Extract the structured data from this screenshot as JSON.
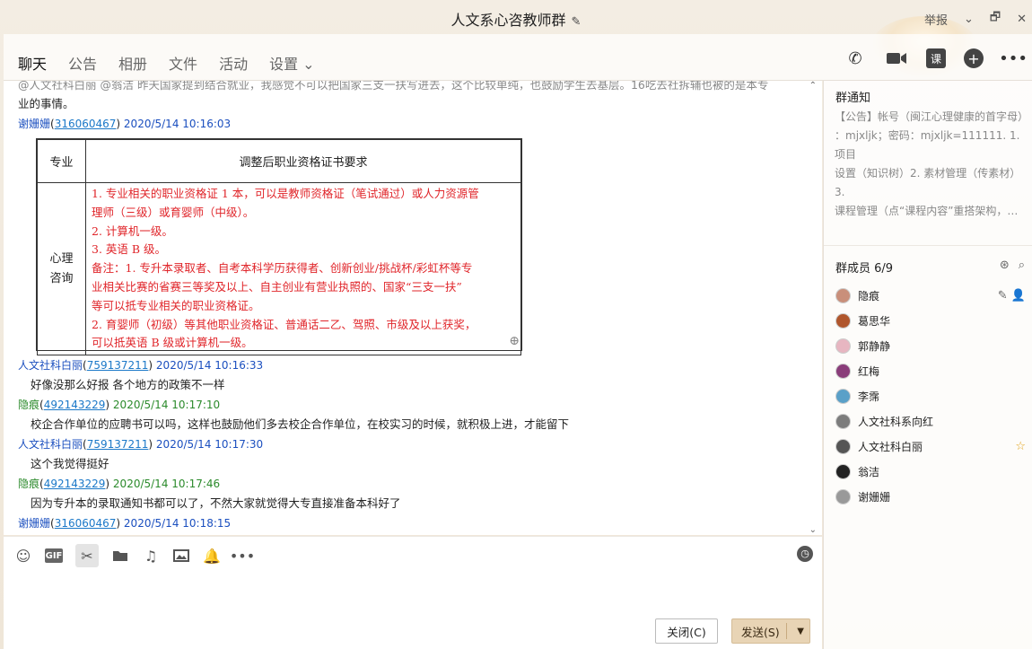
{
  "window": {
    "title": "人文系心咨教师群",
    "report_label": "举报",
    "controls": [
      "⌄",
      "🗗",
      "✕"
    ]
  },
  "tabs": [
    {
      "label": "聊天",
      "active": true
    },
    {
      "label": "公告"
    },
    {
      "label": "相册"
    },
    {
      "label": "文件"
    },
    {
      "label": "活动"
    },
    {
      "label": "设置 ⌄"
    }
  ],
  "toolbar_icons": [
    "phone-icon",
    "video-call-icon",
    "course-icon",
    "add-app-icon",
    "more-icon"
  ],
  "toolbar_text": {
    "course": "课"
  },
  "chat": {
    "partial_top": "@人文社科白丽 @翁洁 昨天国家提到结合就业，我感觉不可以把国家三支一扶写进去，这个比较单纯，也鼓励学生去基层。16吃去社拆辅也被的是本专",
    "partial_tail": "业的事情。",
    "first_meta": {
      "name": "谢姗姗",
      "uid": "316060467",
      "time": "2020/5/14 10:16:03"
    },
    "table_image": {
      "header_col1": "专业",
      "header_col2": "调整后职业资格证书要求",
      "row_label": "心理\n咨询",
      "requirements": [
        "1. 专业相关的职业资格证 1 本，可以是教师资格证（笔试通过）或人力资源管",
        "理师（三级）或育婴师（中级）。",
        "2. 计算机一级。",
        "3. 英语 B 级。",
        "备注：1. 专升本录取者、自考本科学历获得者、创新创业/挑战杯/彩虹杯等专",
        "业相关比赛的省赛三等奖及以上、自主创业有营业执照的、国家“三支一扶”",
        "等可以抵专业相关的职业资格证。",
        "2. 育婴师（初级）等其他职业资格证、普通话二乙、驾照、市级及以上获奖，",
        "可以抵英语 B 级或计算机一级。"
      ]
    },
    "messages": [
      {
        "name": "人文社科白丽",
        "uid": "759137211",
        "time": "2020/5/14 10:16:33",
        "text": "好像没那么好报 各个地方的政策不一样",
        "style": "blue"
      },
      {
        "name": "隐痕",
        "uid": "492143229",
        "time": "2020/5/14 10:17:10",
        "text": "校企合作单位的应聘书可以吗，这样也鼓励他们多去校企合作单位，在校实习的时候，就积极上进，才能留下",
        "style": "green"
      },
      {
        "name": "人文社科白丽",
        "uid": "759137211",
        "time": "2020/5/14 10:17:30",
        "text": "这个我觉得挺好",
        "style": "blue"
      },
      {
        "name": "隐痕",
        "uid": "492143229",
        "time": "2020/5/14 10:17:46",
        "text": "因为专升本的录取通知书都可以了，不然大家就觉得大专直接准备本科好了",
        "style": "green"
      }
    ],
    "last_meta": {
      "name": "谢姗姗",
      "uid": "316060467",
      "time": "2020/5/14 10:18:15"
    }
  },
  "input": {
    "tools": [
      "emoji-icon",
      "gif-icon",
      "screenshot-icon",
      "folder-icon",
      "music-icon",
      "image-icon",
      "bell-icon",
      "more-icon"
    ],
    "gif_label": "GIF",
    "close_label": "关闭(C)",
    "send_label": "发送(S)"
  },
  "sidebar": {
    "notice_title": "群通知",
    "notice_lines": [
      "【公告】帐号（闽江心理健康的首字母）",
      "：mjxljk；密码：mjxljk=111111. 1.项目",
      "设置（知识树）2. 素材管理（传素材）3.",
      "课程管理（点“课程内容”重搭架构，…"
    ],
    "members_title": "群成员 6/9",
    "members": [
      {
        "name": "隐痕",
        "color": "#c98f7a",
        "action": "edit-icon",
        "badge": "👤"
      },
      {
        "name": "葛思华",
        "color": "#b0562c"
      },
      {
        "name": "郭静静",
        "color": "#e7b6c1"
      },
      {
        "name": "红梅",
        "color": "#8a3d7a"
      },
      {
        "name": "李霈",
        "color": "#5aa0c8"
      },
      {
        "name": "人文社科系向红",
        "color": "#7c7c7c"
      },
      {
        "name": "人文社科白丽",
        "color": "#555555",
        "badge": "☆"
      },
      {
        "name": "翁洁",
        "color": "#222222"
      },
      {
        "name": "谢姗姗",
        "color": "#999999"
      }
    ]
  }
}
